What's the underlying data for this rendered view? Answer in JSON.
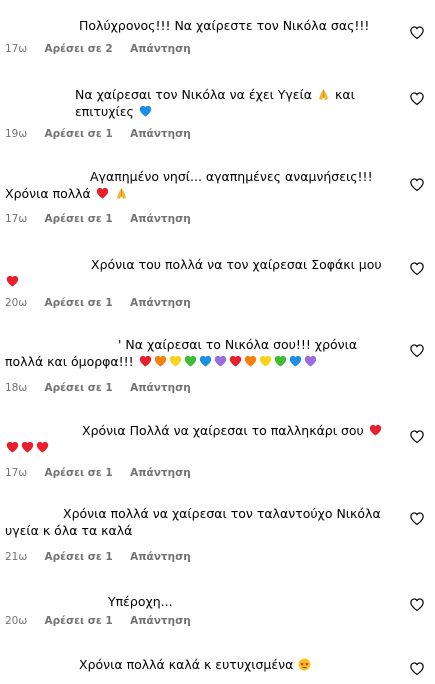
{
  "comments": [
    {
      "text": "Πολύχρονος!!! Να χαίρεστε τον Νικόλα σας!!!",
      "time": "17ω",
      "likes": "Αρέσει σε 2",
      "reply": "Απάντηση"
    },
    {
      "text_a": "Να χαίρεσαι τον Νικόλα να έχει Υγεία",
      "text_b": "και",
      "text_c": "επιτυχίες",
      "time": "19ω",
      "likes": "Αρέσει σε 1",
      "reply": "Απάντηση"
    },
    {
      "text_a": "Αγαπημένο νησί... αγαπημένες αναμνήσεις!!!",
      "text_b": "Χρόνια πολλά",
      "time": "17ω",
      "likes": "Αρέσει σε 1",
      "reply": "Απάντηση"
    },
    {
      "text": "Χρόνια του πολλά να τον χαίρεσαι Σοφάκι μου",
      "time": "20ω",
      "likes": "Αρέσει σε 1",
      "reply": "Απάντηση"
    },
    {
      "text_a": "' Να χαίρεσαι το Νικόλα σου!!! χρόνια",
      "text_b": "πολλά και όμορφα!!!",
      "time": "18ω",
      "likes": "Αρέσει σε 1",
      "reply": "Απάντηση"
    },
    {
      "text": "Χρόνια Πολλά να χαίρεσαι το παλληκάρι σου",
      "time": "17ω",
      "likes": "Αρέσει σε 1",
      "reply": "Απάντηση"
    },
    {
      "text_a": "Χρόνια πολλά να χαίρεσαι τον ταλαντούχο Νικόλα",
      "text_b": "υγεία κ όλα τα καλά",
      "time": "21ω",
      "likes": "Αρέσει σε 1",
      "reply": "Απάντηση"
    },
    {
      "text": "Υπέροχη...",
      "time": "20ω",
      "likes": "Αρέσει σε 1",
      "reply": "Απάντηση"
    },
    {
      "text": "Χρόνια πολλά καλά κ ευτυχισμένα"
    }
  ],
  "icons": {
    "like": "heart-outline-icon",
    "pray": "folded-hands-emoji",
    "blue_heart": "blue-heart-emoji",
    "red_heart": "red-heart-emoji",
    "star_eyes": "star-struck-emoji"
  },
  "colors": {
    "meta_text": "#737373",
    "red": "#e8202e",
    "orange": "#f5800b",
    "yellow": "#fcd21c",
    "green": "#3fbd32",
    "blue": "#1c8fe8",
    "purple": "#9a6de0"
  }
}
